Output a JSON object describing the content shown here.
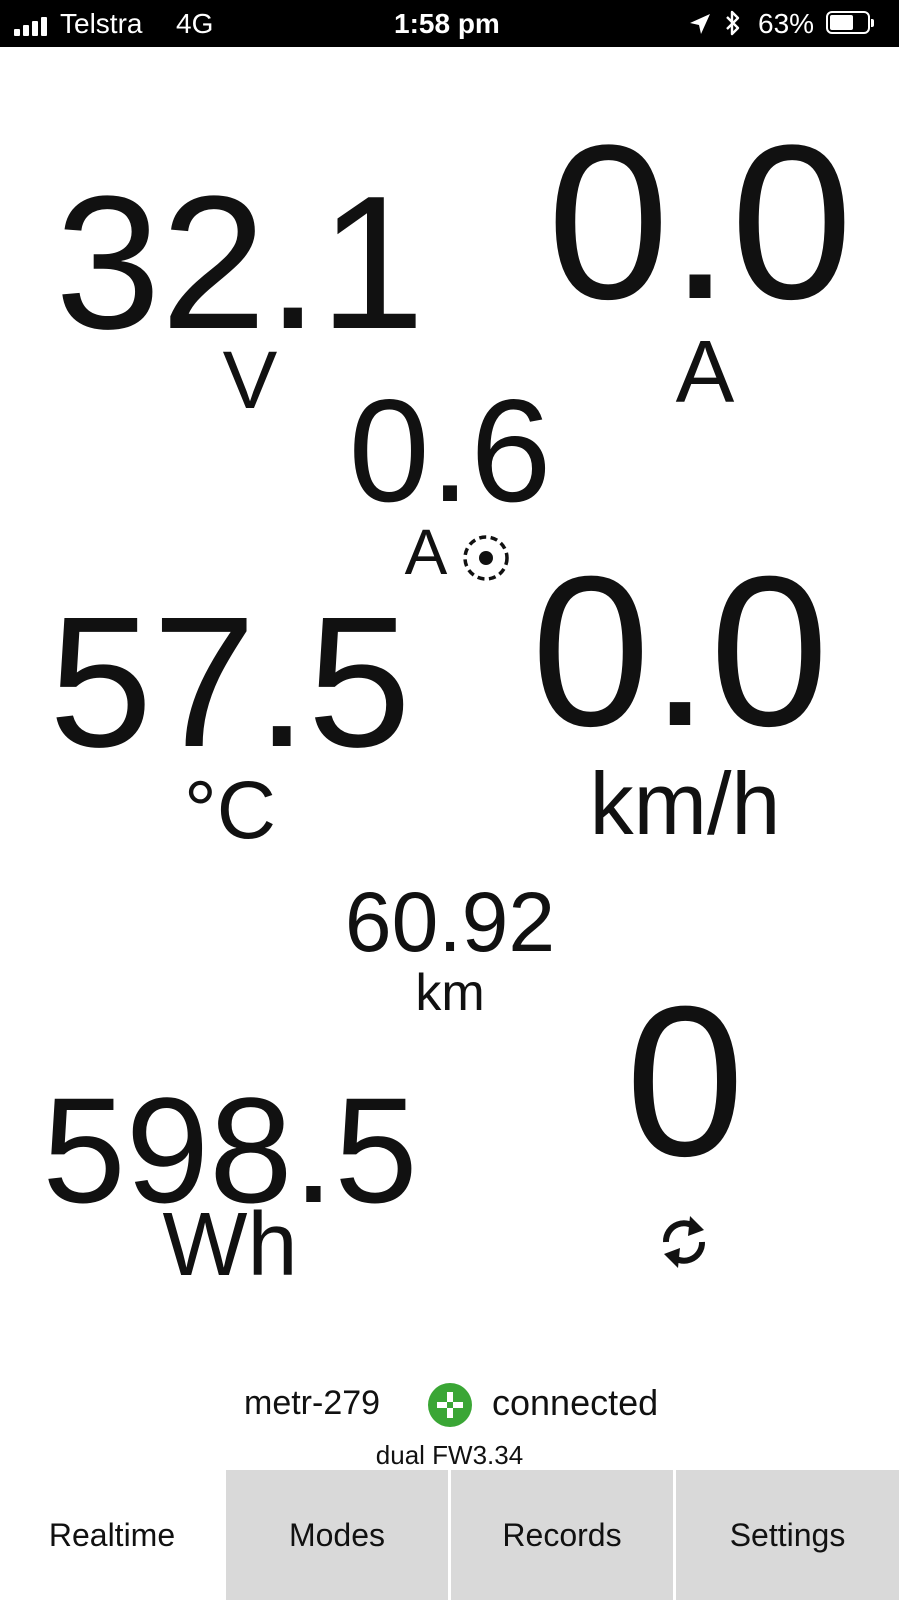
{
  "status_bar": {
    "carrier": "Telstra",
    "network": "4G",
    "time": "1:58 pm",
    "battery_percent": "63%",
    "battery_level": 0.63,
    "icons": [
      "signal-icon",
      "location-arrow-icon",
      "bluetooth-icon",
      "battery-icon"
    ]
  },
  "readings": {
    "voltage": {
      "value": "32.1",
      "unit": "V"
    },
    "current": {
      "value": "0.0",
      "unit": "A"
    },
    "phase_current": {
      "value": "0.6",
      "unit": "A",
      "icon": "motor-phase-icon"
    },
    "temperature": {
      "value": "57.5",
      "unit": "°C"
    },
    "speed": {
      "value": "0.0",
      "unit": "km/h"
    },
    "distance": {
      "value": "60.92",
      "unit": "km"
    },
    "energy": {
      "value": "598.5",
      "unit": "Wh"
    },
    "cycles": {
      "value": "0",
      "icon": "refresh-icon"
    }
  },
  "connection": {
    "device": "metr-279",
    "status": "connected",
    "status_color": "#3aa635",
    "firmware": "dual FW3.34"
  },
  "tabs": [
    {
      "label": "Realtime",
      "active": true
    },
    {
      "label": "Modes",
      "active": false
    },
    {
      "label": "Records",
      "active": false
    },
    {
      "label": "Settings",
      "active": false
    }
  ]
}
